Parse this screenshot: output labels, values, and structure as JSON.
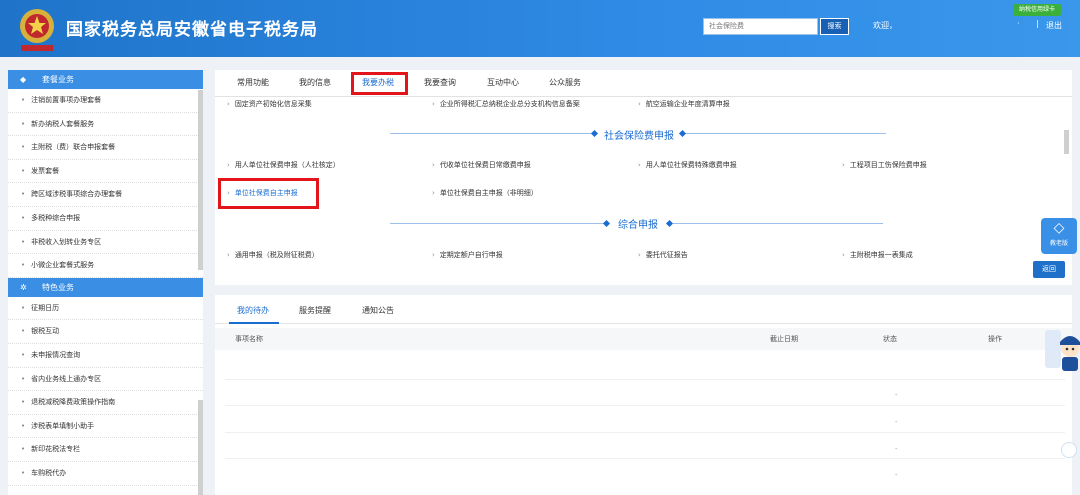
{
  "header": {
    "title": "国家税务总局安徽省电子税务局",
    "search_placeholder": "社会保险费",
    "search_button": "搜索",
    "welcome": "欢迎，",
    "separator": "|",
    "logout": "退出",
    "badge": "纳税信用绿卡",
    "dot": "·"
  },
  "sidebar": {
    "section1": {
      "title": "套餐业务",
      "items": [
        "注销前置事项办理套餐",
        "新办纳税人套餐服务",
        "主附税（费）联合申报套餐",
        "发票套餐",
        "跨区域涉税事项综合办理套餐",
        "多税种综合申报",
        "非税收入划转业务专区",
        "小微企业套餐式服务"
      ]
    },
    "section2": {
      "title": "特色业务",
      "items": [
        "征期日历",
        "银税互动",
        "未申报情况查询",
        "省内业务线上通办专区",
        "退税减税降费政策操作指南",
        "涉税表单填制小助手",
        "新印花税法专栏",
        "车购税代办"
      ]
    }
  },
  "tabs": [
    "常用功能",
    "我的信息",
    "我要办税",
    "我要查询",
    "互动中心",
    "公众服务"
  ],
  "panel1": {
    "top_row": [
      "固定资产初始化信息采集",
      "企业所得税汇总纳税企业总分支机构信息备案",
      "航空运输企业年度清算申报"
    ],
    "section_social": "社会保险费申报",
    "social_row1": [
      "用人单位社保费申报（人社核定）",
      "代收单位社保费日常缴费申报",
      "用人单位社保费特殊缴费申报",
      "工程项目工伤保险费申报"
    ],
    "social_row2": [
      "单位社保费自主申报",
      "单位社保费自主申报（非明细）"
    ],
    "section_comp": "综合申报",
    "comp_row": [
      "通用申报（税及附征税费）",
      "定期定额户自行申报",
      "委托代征报告",
      "主附税申报一表集成"
    ]
  },
  "back_button": "返回",
  "side_tool": "教老版",
  "panel2": {
    "tabs": [
      "我的待办",
      "服务提醒",
      "通知公告"
    ],
    "columns": [
      "事项名称",
      "截止日期",
      "状态",
      "操作"
    ],
    "dash": "-"
  },
  "colors": {
    "header": "#2a84de",
    "accent": "#1a6cd1",
    "highlight": "#e4141b"
  }
}
